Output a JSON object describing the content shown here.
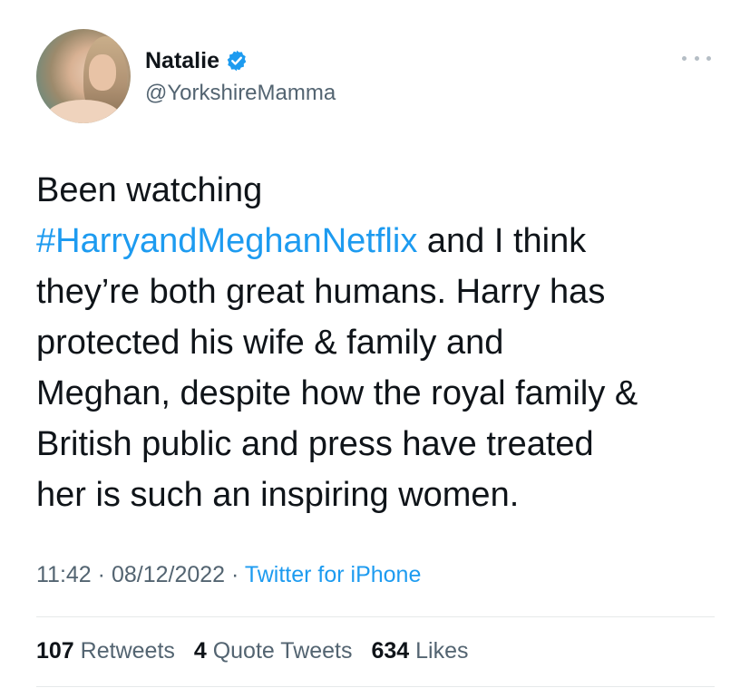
{
  "author": {
    "name": "Natalie",
    "handle": "@YorkshireMamma",
    "verified": true
  },
  "tweet": {
    "line1": "Been watching",
    "hashtag": "#HarryandMeghanNetflix",
    "line2_rest": " and I think",
    "line3": "they’re both great humans. Harry has",
    "line4": "protected his wife & family and",
    "line5": "Meghan, despite how the royal family &",
    "line6": "British public and press have treated",
    "line7": "her is such an inspiring women."
  },
  "meta": {
    "time": "11:42",
    "separator": " · ",
    "date": "08/12/2022",
    "source": "Twitter for iPhone"
  },
  "stats": {
    "retweets_count": "107",
    "retweets_label": "Retweets",
    "quotes_count": "4",
    "quotes_label": "Quote Tweets",
    "likes_count": "634",
    "likes_label": "Likes"
  },
  "colors": {
    "accent": "#1d9bf0",
    "secondary_text": "#536471",
    "primary_text": "#0f1419"
  }
}
